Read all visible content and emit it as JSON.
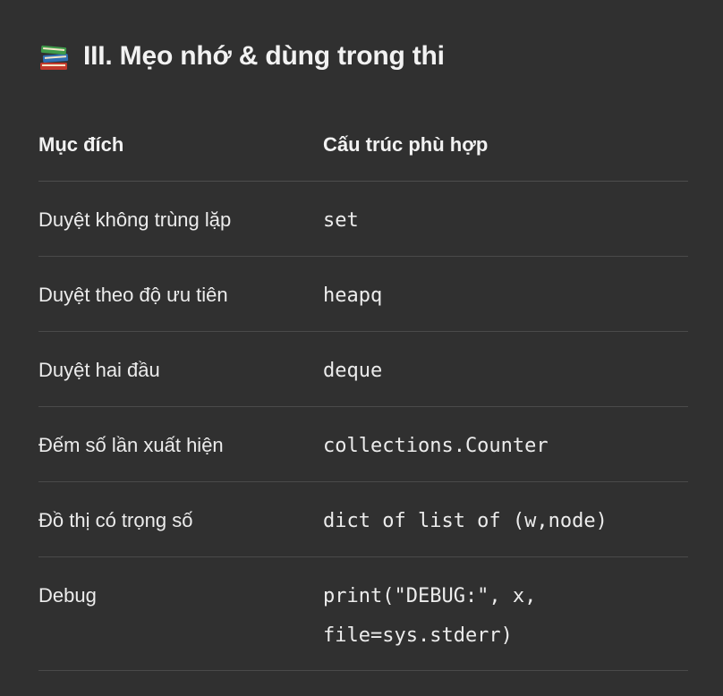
{
  "heading": {
    "icon": "books-icon",
    "title": "III. Mẹo nhớ & dùng trong thi"
  },
  "table": {
    "columns": [
      "Mục đích",
      "Cấu trúc phù hợp"
    ],
    "rows": [
      {
        "purpose": "Duyệt không trùng lặp",
        "structure": "set"
      },
      {
        "purpose": "Duyệt theo độ ưu tiên",
        "structure": "heapq"
      },
      {
        "purpose": "Duyệt hai đầu",
        "structure": "deque"
      },
      {
        "purpose": "Đếm số lần xuất hiện",
        "structure": "collections.Counter"
      },
      {
        "purpose": "Đồ thị có trọng số",
        "structure": "dict of list of (w,node)"
      },
      {
        "purpose": "Debug",
        "structure": "print(\"DEBUG:\", x, file=sys.stderr)"
      }
    ]
  }
}
